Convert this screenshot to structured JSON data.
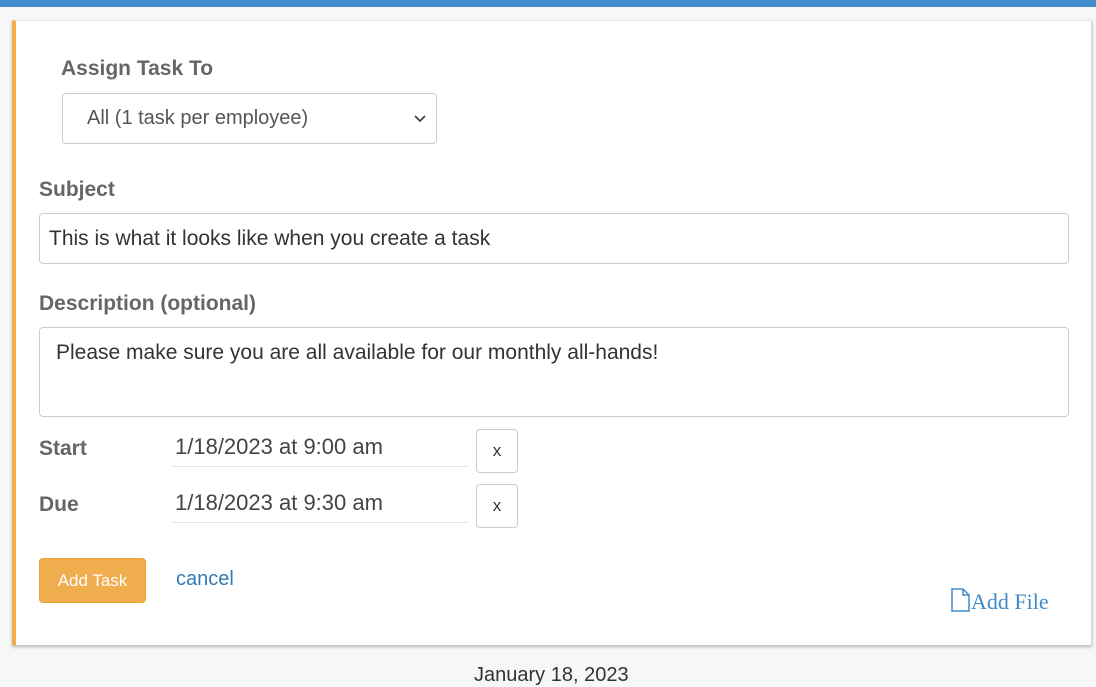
{
  "form": {
    "assign_label": "Assign Task To",
    "assign_selected": "All (1 task per employee)",
    "subject_label": "Subject",
    "subject_value": "This is what it looks like when you create a task",
    "description_label": "Description (optional)",
    "description_value": "Please make sure you are all available for our monthly all-hands!",
    "start_label": "Start",
    "start_value": "1/18/2023 at 9:00 am",
    "due_label": "Due",
    "due_value": "1/18/2023 at 9:30 am",
    "clear_label": "x",
    "add_task_label": "Add Task",
    "cancel_label": "cancel",
    "add_file_label": "Add File"
  },
  "below": {
    "partial_date": "January 18, 2023"
  },
  "colors": {
    "topbar": "#428bca",
    "accent": "#f0ad4e",
    "link": "#337ab7"
  },
  "icons": [
    "chevron-down-icon",
    "file-icon"
  ]
}
